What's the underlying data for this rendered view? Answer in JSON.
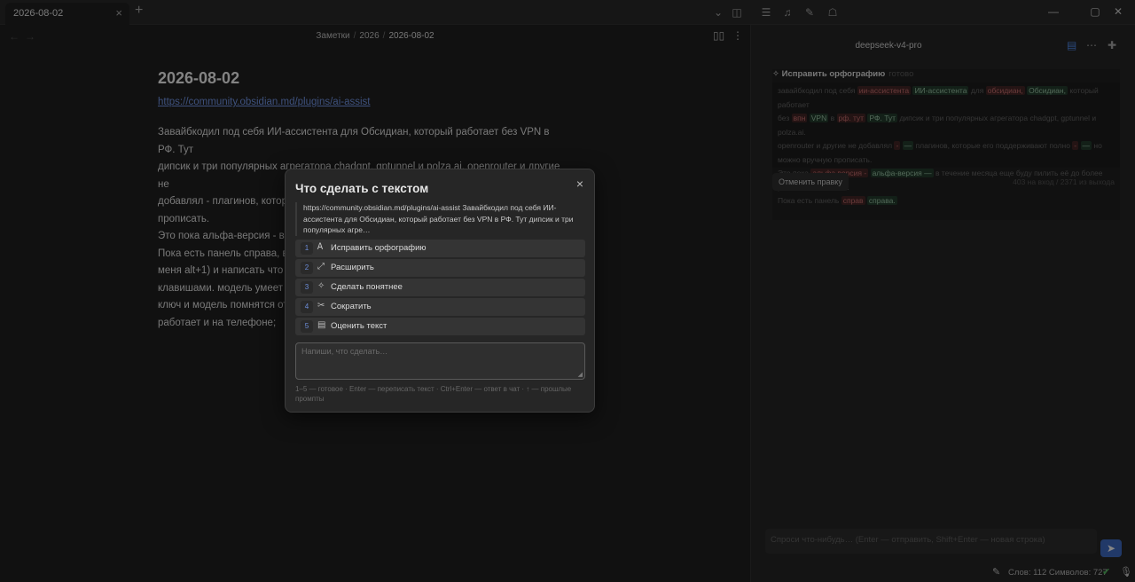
{
  "tab": {
    "title": "2026-08-02",
    "close": "×",
    "new_tab": "+"
  },
  "topbar": {
    "icons": [
      "chevron-down-icon",
      "sidebar-toggle-icon",
      "list-icon",
      "music-icon",
      "pen-icon",
      "bot-icon"
    ],
    "window": {
      "minimize": "—",
      "maximize": "▢",
      "close": "✕"
    }
  },
  "editor": {
    "breadcrumb": {
      "part1": "Заметки",
      "sep": "/",
      "part2": "2026",
      "current": "2026-08-02"
    },
    "note_title": "2026-08-02",
    "link": "https://community.obsidian.md/plugins/ai-assist",
    "body_lines": [
      "Завайбкодил под себя ИИ-ассистента для Обсидиан, который работает без VPN в РФ. Тут",
      "дипсик и три популярных агрегатора chadgpt, gptunnel и polza.ai. openrouter и другие не",
      "добавлял - плагинов, которые его поддерживают полно, но можно вручную прописать.",
      "Это пока альфа-версия - в те",
      "Пока есть панель справа, во",
      "меня alt+1) и написать что х",
      "клавишами. модель умеет пр",
      "ключ и модель помнятся отд",
      "работает и на телефоне;"
    ]
  },
  "panel": {
    "model": "deepseek-v4-pro",
    "card_title": "Исправить орфографию",
    "card_state": "готово",
    "diff": {
      "l1_a": "завайбкодил под себя ",
      "l1_del1": "ии-ассистента",
      "l1_ins1": "ИИ-ассистента",
      "l1_b": " для ",
      "l1_del2": "обсидиан,",
      "l1_ins2": "Обсидиан,",
      "l1_c": " который работает",
      "l2_a": "без ",
      "l2_del1": "впн",
      "l2_ins1": "VPN",
      "l2_b": " в ",
      "l2_del2": "рф. тут",
      "l2_ins2": "РФ. Тут",
      "l2_c": " дипсик и три популярных агрегатора chadgpt, gptunnel и polza.ai.",
      "l3_a": "openrouter и другие не добавлял ",
      "l3_del": "-",
      "l3_ins": "—",
      "l3_b": " плагинов, которые его поддерживают полно ",
      "l3_del2": "-",
      "l3_ins2": "—",
      "l3_c": " но",
      "l4": "можно вручную прописать.",
      "l5_a": "Это пока ",
      "l5_del": "альфа версия -",
      "l5_ins": "альфа-версия —",
      "l5_b": " в течение месяца еще буду пилить её до более",
      "l6": "рабочего состояния.",
      "l7_a": "Пока есть панель ",
      "l7_del": "справ",
      "l7_ins": "справа.",
      "l7_b": ""
    },
    "undo_label": "Отменить правку",
    "counts": "403 на вход / 2371 из выхода",
    "chat_placeholder": "Спроси что-нибудь… (Enter — отправить, Shift+Enter — новая строка)",
    "send_icon": "➤",
    "status": "Слов: 112   Символов: 727"
  },
  "modal": {
    "title": "Что сделать с текстом",
    "close": "×",
    "quote": "https://community.obsidian.md/plugins/ai-assist Завайбкодил под себя ИИ-ассистента для Обсидиан, который работает без VPN в РФ. Тут дипсик и три популярных агре…",
    "actions": [
      {
        "num": "1",
        "icon": "spellcheck-icon",
        "glyph": "Ꭺ",
        "label": "Исправить орфографию"
      },
      {
        "num": "2",
        "icon": "expand-icon",
        "glyph": "⤢",
        "label": "Расширить"
      },
      {
        "num": "3",
        "icon": "sparkles-icon",
        "glyph": "✧",
        "label": "Сделать понятнее"
      },
      {
        "num": "4",
        "icon": "scissors-icon",
        "glyph": "✂",
        "label": "Сократить"
      },
      {
        "num": "5",
        "icon": "clipboard-icon",
        "glyph": "▤",
        "label": "Оценить текст"
      }
    ],
    "prompt_placeholder": "Напиши, что сделать…",
    "hint": "1–5 — готовое · Enter — переписать текст · Ctrl+Enter — ответ в чат · ↑ — прошлые промпты"
  }
}
